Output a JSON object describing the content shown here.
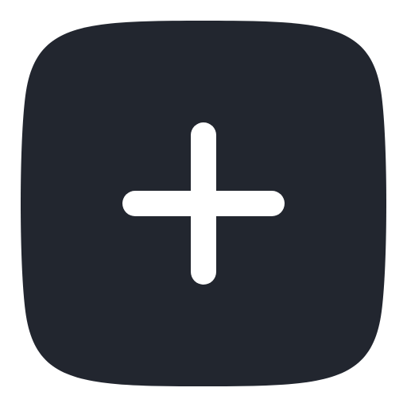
{
  "icon": {
    "name": "plus-square-icon",
    "background_color": "#22262f",
    "glyph_color": "#ffffff"
  }
}
